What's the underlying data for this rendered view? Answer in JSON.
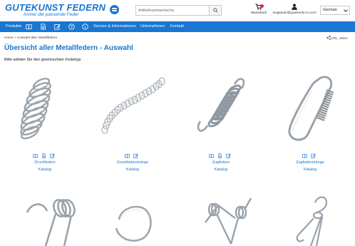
{
  "brand": {
    "name": "GUTEKUNST FEDERN",
    "tagline": "Immer die passende Feder",
    "color": "#1976d2"
  },
  "search": {
    "placeholder": "Artikelnummersuche",
    "icon": "search-icon"
  },
  "cart": {
    "label": "Warenkorb",
    "icon": "cart-icon"
  },
  "user": {
    "label": "mugsauer@gutekunst-co.com",
    "icon": "user-icon"
  },
  "language": {
    "selected": "German"
  },
  "nav": {
    "items": [
      {
        "label": "Produkte"
      },
      {
        "label": "Service & Informationen"
      },
      {
        "label": "Unternehmen"
      },
      {
        "label": "Kontakt"
      }
    ],
    "icons": [
      "catalog-icon",
      "document-icon",
      "edit-icon",
      "help-icon",
      "info-icon"
    ]
  },
  "breadcrumb": {
    "text": "Home » Auswahl aller Metallfedern"
  },
  "share": {
    "label": "teilen",
    "prefix": "URL"
  },
  "page": {
    "title": "Übersicht aller Metallfedern - Auswahl",
    "subtitle": "Bitte wählen Sie den gewünschten Federtyp"
  },
  "products": [
    {
      "name": "Druckfedern",
      "link": "Katalog",
      "icons": [
        "catalog-icon",
        "document-icon",
        "edit-icon"
      ]
    },
    {
      "name": "Druckfederstränge",
      "link": "Katalog",
      "icons": [
        "catalog-icon",
        "edit-icon"
      ]
    },
    {
      "name": "Zugfedern",
      "link": "Katalog",
      "icons": [
        "catalog-icon",
        "document-icon",
        "edit-icon"
      ]
    },
    {
      "name": "Zugfederstränge",
      "link": "Katalog",
      "icons": [
        "catalog-icon",
        "edit-icon"
      ]
    }
  ],
  "colors": {
    "accent": "#1976d2",
    "badge": "#e5197e",
    "spring": "#9aa3ab"
  }
}
